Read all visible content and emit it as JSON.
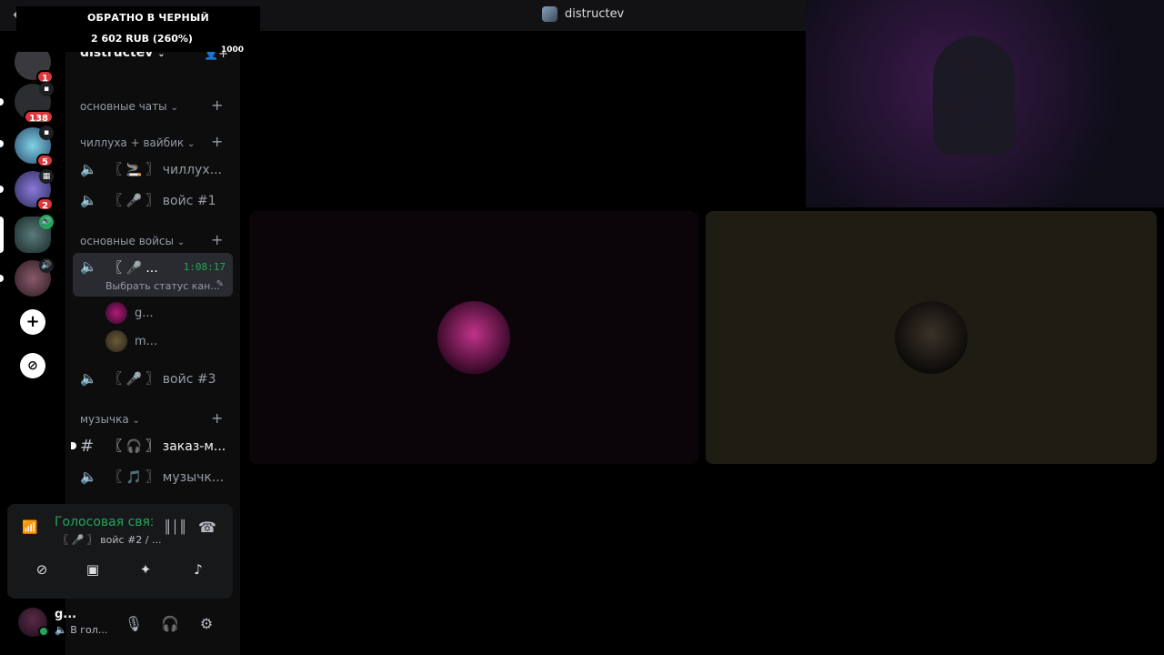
{
  "title_bar": {
    "back_icon": "←",
    "forward_icon": "→",
    "channel_title": "distructev"
  },
  "stream_overlay": {
    "line1": "ОБРАТНО В ЧЕРНЫЙ",
    "line2": "2 602 RUB (260%)",
    "line3": "1000"
  },
  "servers": [
    {
      "badge": "1"
    },
    {
      "badge": "138"
    },
    {
      "badge": "5"
    },
    {
      "badge": "2"
    },
    {
      "badge": ""
    },
    {
      "badge": ""
    }
  ],
  "server_rail_buttons": {
    "add_server": "+",
    "discover": "⊘"
  },
  "sidebar": {
    "server_name": "distructev",
    "server_name_chevron": "⌄",
    "categories": [
      {
        "label": "основные чаты"
      },
      {
        "label": "чиллуха + вайбик"
      },
      {
        "label": "основные войсы"
      },
      {
        "label": "музычка"
      }
    ],
    "category_chevron": "⌄",
    "channels": [
      {
        "name": "〖 🚬 〗 чиллух...",
        "type": "voice"
      },
      {
        "name": "〖 🎤 〗 войс #1",
        "type": "voice"
      },
      {
        "name": "〖 🎤 ...",
        "type": "voice",
        "timer": "1:08:17",
        "status": "Выбрать статус кан..."
      },
      {
        "name": "〖 🎤 〗 войс #3",
        "type": "voice"
      },
      {
        "name": "〖 🎧 〗 заказ-м...",
        "type": "text"
      },
      {
        "name": "〖 🎵 〗 музычк...",
        "type": "voice"
      }
    ],
    "voice_users": [
      {
        "name": "g..."
      },
      {
        "name": "m..."
      }
    ]
  },
  "voice_panel": {
    "connection_label": "Голосовая связ",
    "channel_label": "〖 🎤 〗 войс #2 / ..."
  },
  "user_panel": {
    "name": "g...",
    "status": "В гол..."
  },
  "colors": {
    "accent_green": "#23a55a",
    "badge_red": "#da373c",
    "sidebar_bg": "#0d0d0e",
    "tile_left": "#0b0509",
    "tile_right": "#1e1c13"
  }
}
